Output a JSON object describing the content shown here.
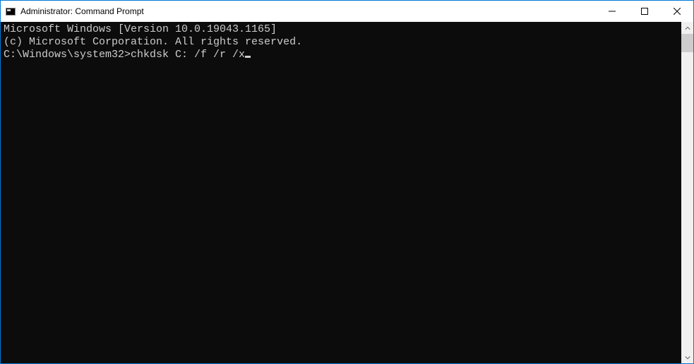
{
  "titlebar": {
    "title": "Administrator: Command Prompt"
  },
  "terminal": {
    "line1": "Microsoft Windows [Version 10.0.19043.1165]",
    "line2": "(c) Microsoft Corporation. All rights reserved.",
    "blank": "",
    "prompt": "C:\\Windows\\system32>",
    "command": "chkdsk C: /f /r /x"
  }
}
